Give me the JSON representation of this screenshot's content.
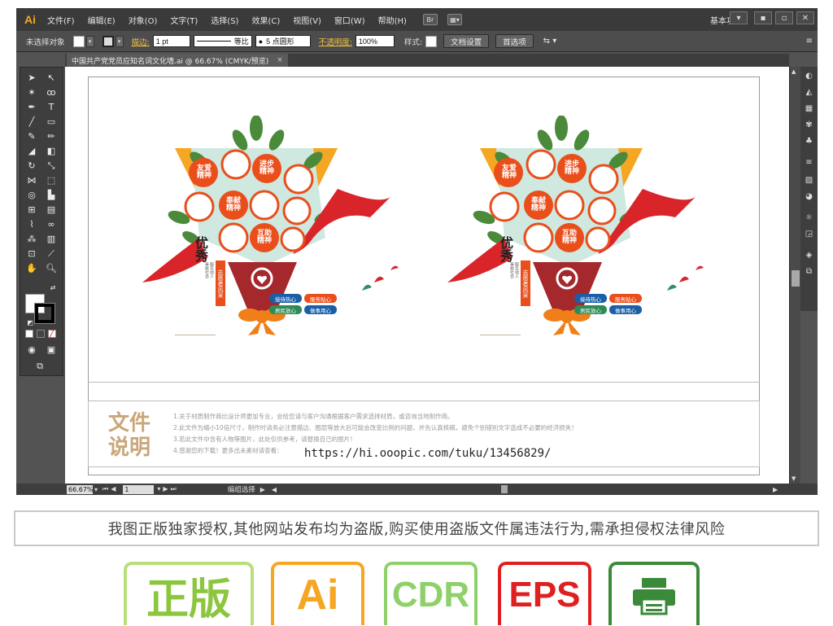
{
  "app": {
    "logo": "Ai",
    "menu": [
      "文件(F)",
      "编辑(E)",
      "对象(O)",
      "文字(T)",
      "选择(S)",
      "效果(C)",
      "视图(V)",
      "窗口(W)",
      "帮助(H)"
    ],
    "bridge_icon": "Br",
    "workspace": "基本功能",
    "window_buttons": [
      "▾",
      "▪",
      "▫",
      "✕"
    ]
  },
  "control_bar": {
    "selection_status": "未选择对象",
    "stroke_label": "描边:",
    "stroke_width": "1 pt",
    "stroke_profile": "等比",
    "brush": "5 点圆形",
    "opacity_label": "不透明度:",
    "opacity_value": "100%",
    "style_label": "样式:",
    "doc_setup_button": "文档设置",
    "preferences_button": "首选项"
  },
  "document": {
    "tab_title": "中国共产党党员应知名词文化墙.ai @ 66.67% (CMYK/预览)",
    "tab_close": "×"
  },
  "artwork": {
    "panels": [
      {
        "circle_labels": [
          "友爱\n精神",
          "进步\n精神",
          "奉献\n精神",
          "互助\n精神"
        ],
        "title": "优秀",
        "subtitle": "志愿者风采",
        "small_vertical": "服务他人\n奉献社会",
        "tags": [
          "接待热心",
          "服务贴心",
          "居民放心",
          "做事用心"
        ]
      },
      {
        "circle_labels": [
          "友爱\n精神",
          "进步\n精神",
          "奉献\n精神",
          "互助\n精神"
        ],
        "title": "优秀",
        "subtitle": "志愿者风采",
        "small_vertical": "服务他人\n奉献社会",
        "tags": [
          "接待热心",
          "服务贴心",
          "居民放心",
          "做事用心"
        ]
      }
    ]
  },
  "notes": {
    "title": "文件\n说明",
    "lines": [
      "1.关于材质制作商比设计师更加专业，会给您请与客户沟通根据客户需求选择材质，或咨询当地制作商。",
      "2.此文件为缩小10倍尺寸，制作时请务必注意描边、图层等放大后可能会改变比例的问题，并先认真核稿，避免个别错别文字造成不必要的经济损失！",
      "3.若此文件中含有人物等图片，此处仅供参考，请替换自己的图片！",
      "4.感谢您的下载！更多出未素材请查看："
    ],
    "url": "https://hi.ooopic.com/tuku/13456829/"
  },
  "status_bar": {
    "zoom": "66.67%",
    "page": "1",
    "status": "编组选择"
  },
  "banner": {
    "text": "我图正版独家授权,其他网站发布均为盗版,购买使用盗版文件属违法行为,需承担侵权法律风险"
  },
  "badges": [
    {
      "label": "正版",
      "color": "#8cc63f"
    },
    {
      "label": "Ai",
      "color": "#f5a623"
    },
    {
      "label": "CDR",
      "color": "#8ed16a"
    },
    {
      "label": "EPS",
      "color": "#e02020"
    },
    {
      "label": "",
      "icon": "printer-icon",
      "color": "#3a8a3a"
    }
  ],
  "colors": {
    "accent_orange": "#f5a623",
    "stroke_label_yellow": "#f0c040",
    "ribbon_red": "#d9252a",
    "wrap_dark_red": "#a5282c",
    "leaf_green": "#4a8a3a",
    "bouquet_mint": "#cfe8e0",
    "notes_tan": "#c9a67a"
  }
}
